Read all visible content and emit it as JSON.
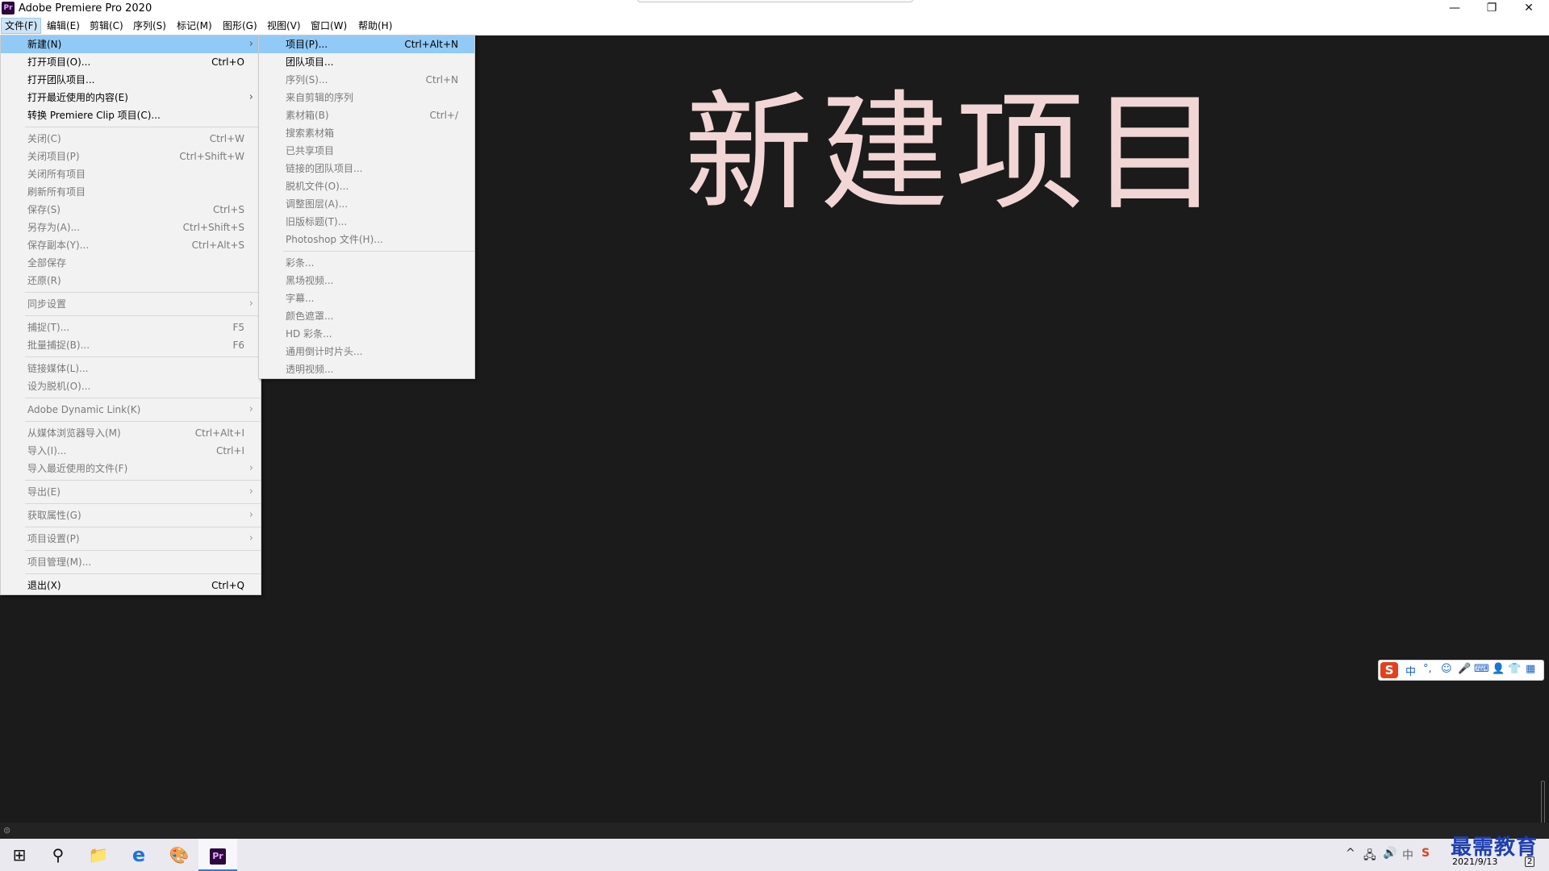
{
  "window": {
    "app_icon": "Pr",
    "title": "Adobe Premiere Pro 2020",
    "minimize": "—",
    "restore": "❐",
    "close": "✕"
  },
  "menubar": [
    {
      "label": "文件(F)",
      "active": true
    },
    {
      "label": "编辑(E)"
    },
    {
      "label": "剪辑(C)"
    },
    {
      "label": "序列(S)"
    },
    {
      "label": "标记(M)"
    },
    {
      "label": "图形(G)"
    },
    {
      "label": "视图(V)"
    },
    {
      "label": "窗口(W)"
    },
    {
      "label": "帮助(H)"
    }
  ],
  "file_menu": {
    "groups": [
      [
        {
          "label": "新建(N)",
          "submenu": true,
          "highlighted": true
        },
        {
          "label": "打开项目(O)...",
          "shortcut": "Ctrl+O"
        },
        {
          "label": "打开团队项目..."
        },
        {
          "label": "打开最近使用的内容(E)",
          "submenu": true
        },
        {
          "label": "转换 Premiere Clip 项目(C)..."
        }
      ],
      [
        {
          "label": "关闭(C)",
          "shortcut": "Ctrl+W",
          "disabled": true
        },
        {
          "label": "关闭项目(P)",
          "shortcut": "Ctrl+Shift+W",
          "disabled": true
        },
        {
          "label": "关闭所有项目",
          "disabled": true
        },
        {
          "label": "刷新所有项目",
          "disabled": true
        },
        {
          "label": "保存(S)",
          "shortcut": "Ctrl+S",
          "disabled": true
        },
        {
          "label": "另存为(A)...",
          "shortcut": "Ctrl+Shift+S",
          "disabled": true
        },
        {
          "label": "保存副本(Y)...",
          "shortcut": "Ctrl+Alt+S",
          "disabled": true
        },
        {
          "label": "全部保存",
          "disabled": true
        },
        {
          "label": "还原(R)",
          "disabled": true
        }
      ],
      [
        {
          "label": "同步设置",
          "submenu": true,
          "disabled": true
        }
      ],
      [
        {
          "label": "捕捉(T)...",
          "shortcut": "F5",
          "disabled": true
        },
        {
          "label": "批量捕捉(B)...",
          "shortcut": "F6",
          "disabled": true
        }
      ],
      [
        {
          "label": "链接媒体(L)...",
          "disabled": true
        },
        {
          "label": "设为脱机(O)...",
          "disabled": true
        }
      ],
      [
        {
          "label": "Adobe Dynamic Link(K)",
          "submenu": true,
          "disabled": true
        }
      ],
      [
        {
          "label": "从媒体浏览器导入(M)",
          "shortcut": "Ctrl+Alt+I",
          "disabled": true
        },
        {
          "label": "导入(I)...",
          "shortcut": "Ctrl+I",
          "disabled": true
        },
        {
          "label": "导入最近使用的文件(F)",
          "submenu": true,
          "disabled": true
        }
      ],
      [
        {
          "label": "导出(E)",
          "submenu": true,
          "disabled": true
        }
      ],
      [
        {
          "label": "获取属性(G)",
          "submenu": true,
          "disabled": true
        }
      ],
      [
        {
          "label": "项目设置(P)",
          "submenu": true,
          "disabled": true
        }
      ],
      [
        {
          "label": "项目管理(M)...",
          "disabled": true
        }
      ],
      [
        {
          "label": "退出(X)",
          "shortcut": "Ctrl+Q"
        }
      ]
    ]
  },
  "new_submenu": {
    "groups": [
      [
        {
          "label": "项目(P)...",
          "shortcut": "Ctrl+Alt+N",
          "highlighted": true
        },
        {
          "label": "团队项目..."
        },
        {
          "label": "序列(S)...",
          "shortcut": "Ctrl+N",
          "disabled": true
        },
        {
          "label": "来自剪辑的序列",
          "disabled": true
        },
        {
          "label": "素材箱(B)",
          "shortcut": "Ctrl+/",
          "disabled": true
        },
        {
          "label": "搜索素材箱",
          "disabled": true
        },
        {
          "label": "已共享项目",
          "disabled": true
        },
        {
          "label": "链接的团队项目...",
          "disabled": true
        },
        {
          "label": "脱机文件(O)...",
          "disabled": true
        },
        {
          "label": "调整图层(A)...",
          "disabled": true
        },
        {
          "label": "旧版标题(T)...",
          "disabled": true
        },
        {
          "label": "Photoshop 文件(H)...",
          "disabled": true
        }
      ],
      [
        {
          "label": "彩条...",
          "disabled": true
        },
        {
          "label": "黑场视频...",
          "disabled": true
        },
        {
          "label": "字幕...",
          "disabled": true
        },
        {
          "label": "颜色遮罩...",
          "disabled": true
        },
        {
          "label": "HD 彩条...",
          "disabled": true
        },
        {
          "label": "通用倒计时片头...",
          "disabled": true
        },
        {
          "label": "透明视频...",
          "disabled": true
        }
      ]
    ]
  },
  "overlay_title": "新建项目",
  "ime_toolbar": {
    "logo": "S",
    "items": [
      "中",
      "°,",
      "☺",
      "🎤",
      "⌨",
      "👤",
      "👕",
      "▦"
    ]
  },
  "taskbar": {
    "items": [
      {
        "name": "start-button",
        "icon": "windows-logo-icon",
        "glyph": "⊞"
      },
      {
        "name": "search-button",
        "icon": "search-icon",
        "glyph": "⚲"
      },
      {
        "name": "file-explorer-button",
        "icon": "folder-icon",
        "glyph": "📁"
      },
      {
        "name": "edge-button",
        "icon": "edge-icon",
        "glyph": "e"
      },
      {
        "name": "paint-button",
        "icon": "paint-icon",
        "glyph": "🎨"
      },
      {
        "name": "premiere-button",
        "icon": "premiere-icon",
        "glyph": "Pr",
        "active": true
      }
    ],
    "tray_icons": [
      "^",
      "🖧",
      "🔊",
      "中",
      "S"
    ],
    "date": "2021/9/13",
    "notification_count": "2"
  },
  "watermark": "最需教育",
  "colors": {
    "menu_highlight": "#91c9f7",
    "overlay_title": "#f2d5d5",
    "workspace_bg": "#1b1b1b"
  }
}
